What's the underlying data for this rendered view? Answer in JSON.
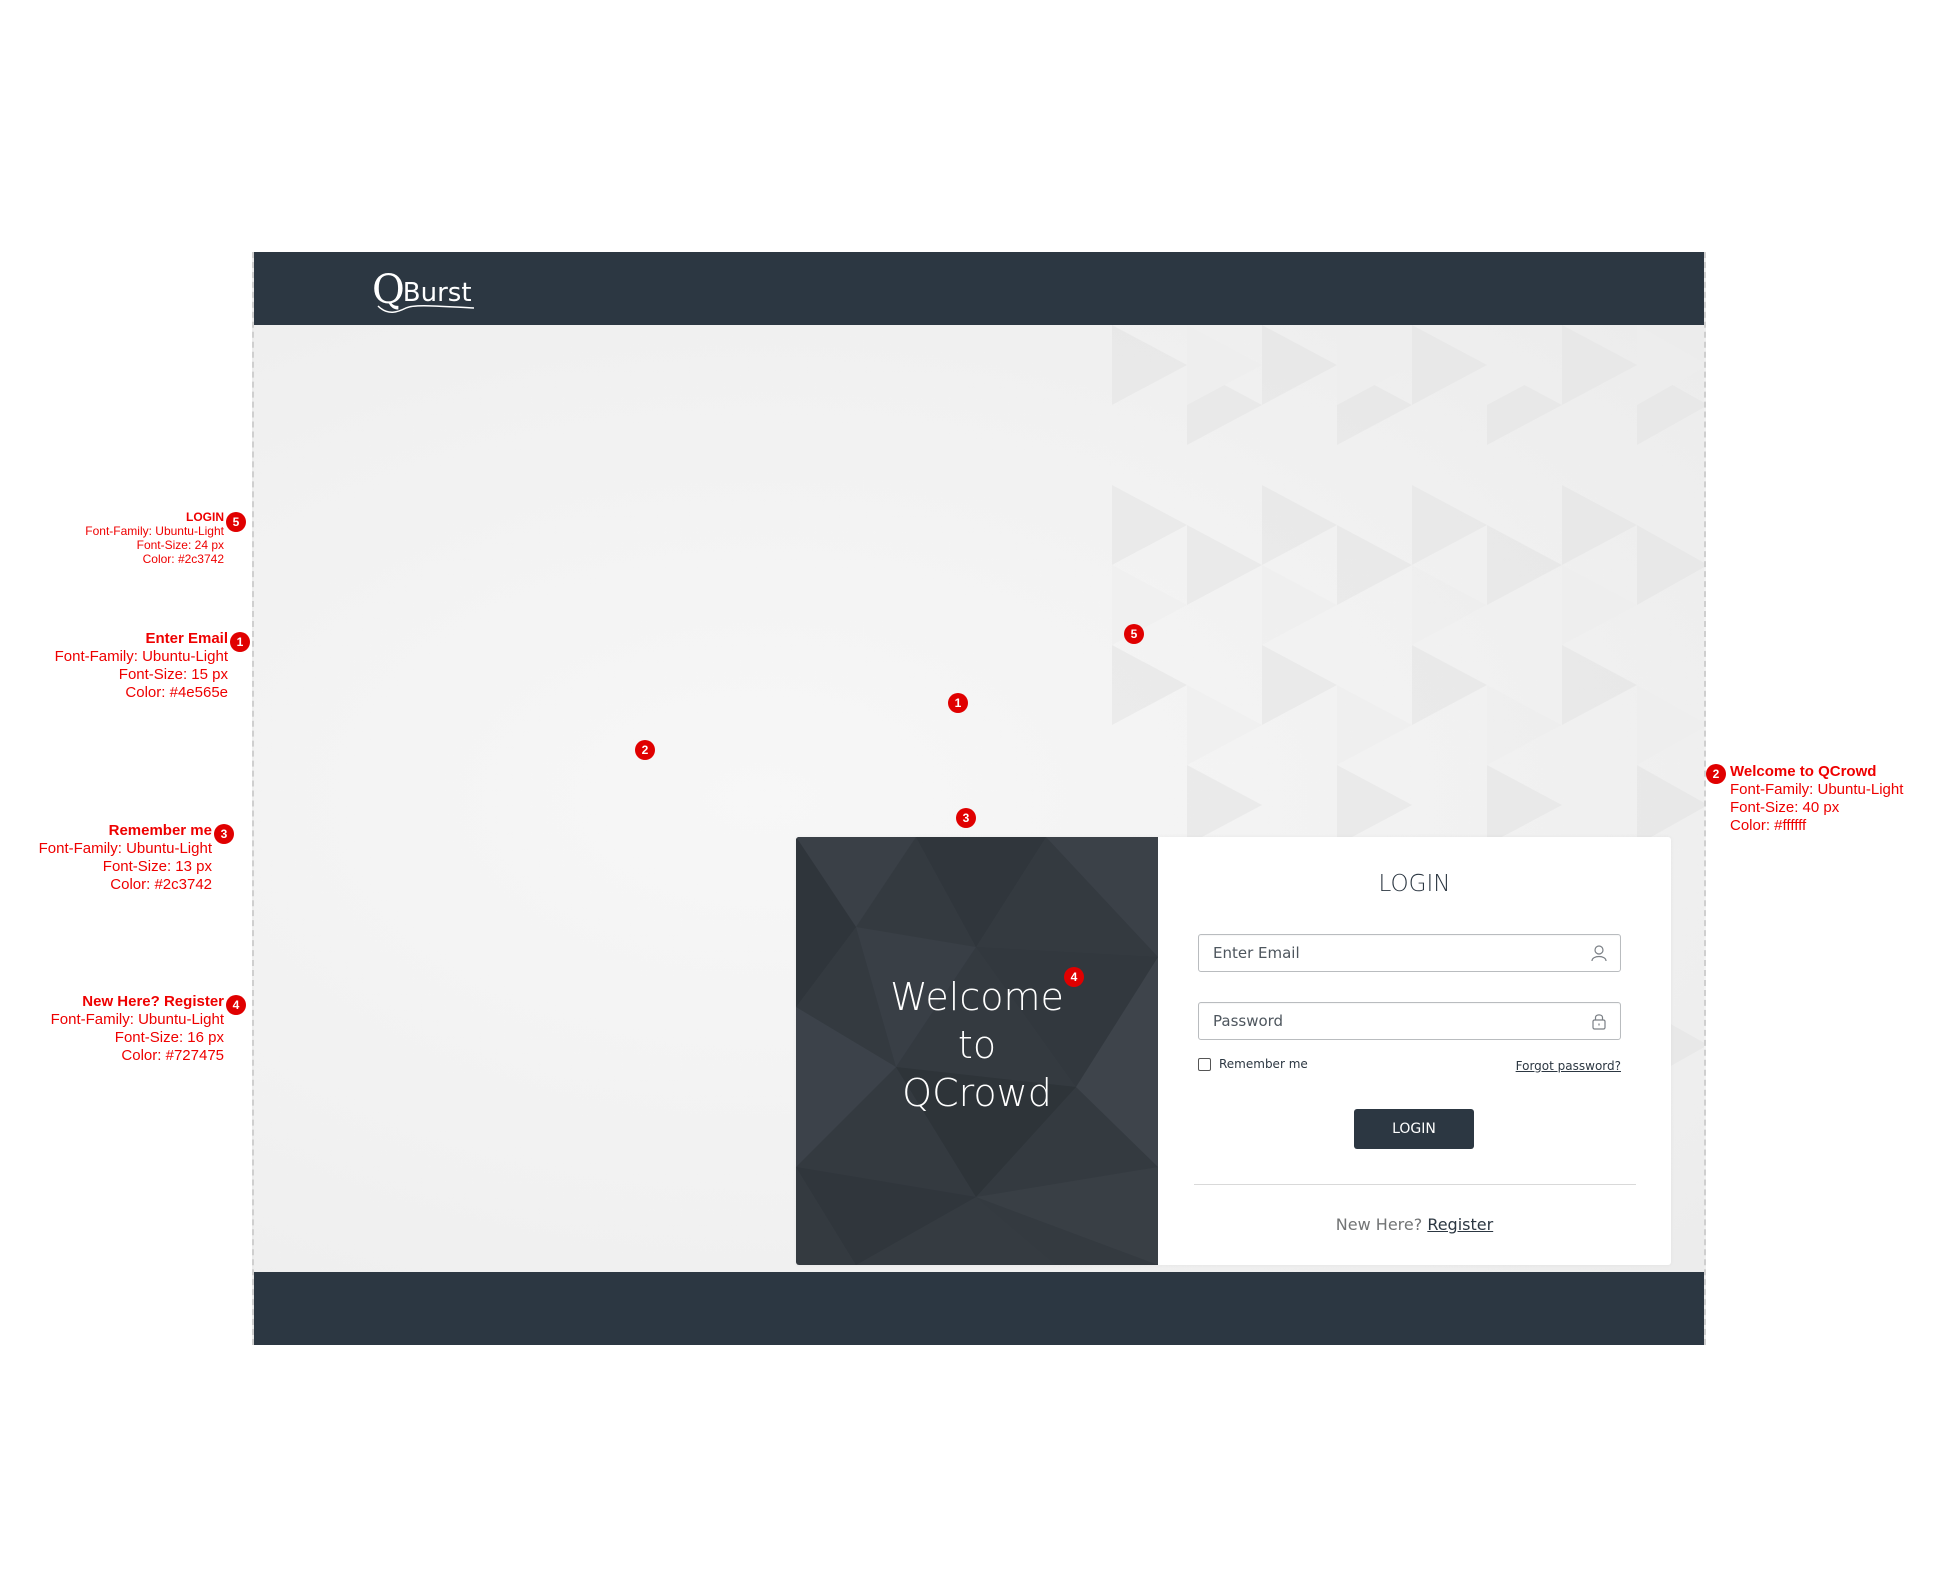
{
  "header": {
    "logo_q": "Q",
    "logo_rest": "Burst"
  },
  "welcome": {
    "line1": "Welcome",
    "line2": "to",
    "line3": "QCrowd"
  },
  "login": {
    "title": "LOGIN",
    "email_placeholder": "Enter Email",
    "password_placeholder": "Password",
    "remember_label": "Remember me",
    "forgot_label": "Forgot password?",
    "button_label": "LOGIN",
    "new_here": "New Here?",
    "register_label": "Register"
  },
  "badges": [
    "1",
    "2",
    "3",
    "4",
    "5"
  ],
  "annotations": {
    "login": {
      "title": "LOGIN",
      "font_family": "Font-Family: Ubuntu-Light",
      "font_size": "Font-Size: 24 px",
      "color": "Color: #2c3742"
    },
    "email": {
      "title": "Enter Email",
      "font_family": "Font-Family: Ubuntu-Light",
      "font_size": "Font-Size: 15 px",
      "color": "Color: #4e565e"
    },
    "remember": {
      "title": "Remember me",
      "font_family": "Font-Family: Ubuntu-Light",
      "font_size": "Font-Size: 13 px",
      "color": "Color: #2c3742"
    },
    "register": {
      "title": "New Here? Register",
      "font_family": "Font-Family: Ubuntu-Light",
      "font_size": "Font-Size: 16 px",
      "color": "Color: #727475"
    },
    "welcome": {
      "title": "Welcome to QCrowd",
      "font_family": "Font-Family: Ubuntu-Light",
      "font_size": "Font-Size: 40 px",
      "color": "Color: #ffffff"
    }
  },
  "colors": {
    "dark": "#2c3742",
    "annotation": "#ee0000",
    "badge": "#e00000"
  },
  "icons": {
    "email": "user-icon",
    "password": "lock-icon"
  }
}
